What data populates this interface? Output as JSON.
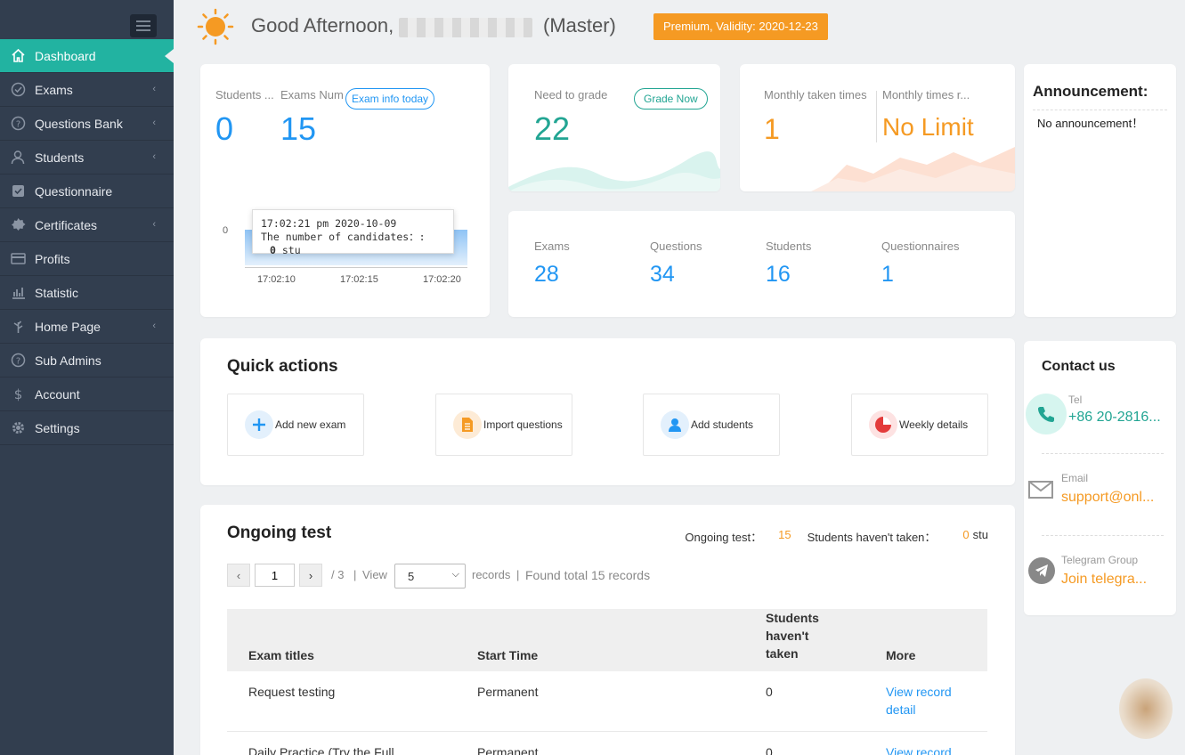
{
  "sidebar": {
    "items": [
      {
        "label": "Dashboard",
        "icon": "home-icon",
        "active": true,
        "has_chevron": false
      },
      {
        "label": "Exams",
        "icon": "check-circle-icon",
        "active": false,
        "has_chevron": true
      },
      {
        "label": "Questions Bank",
        "icon": "question-circle-icon",
        "active": false,
        "has_chevron": true
      },
      {
        "label": "Students",
        "icon": "user-icon",
        "active": false,
        "has_chevron": true
      },
      {
        "label": "Questionnaire",
        "icon": "checkbox-icon",
        "active": false,
        "has_chevron": false
      },
      {
        "label": "Certificates",
        "icon": "badge-icon",
        "active": false,
        "has_chevron": true
      },
      {
        "label": "Profits",
        "icon": "card-icon",
        "active": false,
        "has_chevron": false
      },
      {
        "label": "Statistic",
        "icon": "bar-chart-icon",
        "active": false,
        "has_chevron": false
      },
      {
        "label": "Home Page",
        "icon": "leaf-icon",
        "active": false,
        "has_chevron": true
      },
      {
        "label": "Sub Admins",
        "icon": "question-circle-icon",
        "active": false,
        "has_chevron": false
      },
      {
        "label": "Account",
        "icon": "dollar-icon",
        "active": false,
        "has_chevron": false
      },
      {
        "label": "Settings",
        "icon": "gear-icon",
        "active": false,
        "has_chevron": false
      }
    ]
  },
  "header": {
    "greeting": "Good Afternoon,",
    "role": "(Master)",
    "premium": "Premium, Validity: 2020-12-23"
  },
  "exam_today": {
    "students_label": "Students ...",
    "exams_label": "Exams Num",
    "info_button": "Exam info today",
    "students_value": "0",
    "exams_value": "15",
    "chart_y_tick": "0",
    "tooltip_time": "17:02:21 pm 2020-10-09",
    "tooltip_label": "The number of candidates：:",
    "tooltip_value": "0",
    "tooltip_unit": "stu",
    "x_ticks": [
      "17:02:10",
      "17:02:15",
      "17:02:20"
    ]
  },
  "grade": {
    "label": "Need to grade",
    "button": "Grade Now",
    "value": "22"
  },
  "monthly": {
    "taken_label": "Monthly taken times",
    "remaining_label": "Monthly times r...",
    "taken_value": "1",
    "remaining_value": "No Limit"
  },
  "totals": [
    {
      "label": "Exams",
      "value": "28"
    },
    {
      "label": "Questions",
      "value": "34"
    },
    {
      "label": "Students",
      "value": "16"
    },
    {
      "label": "Questionnaires",
      "value": "1"
    }
  ],
  "announcement": {
    "title": "Announcement:",
    "text": "No announcement！"
  },
  "quick_actions": {
    "title": "Quick actions",
    "items": [
      {
        "label": "Add new exam",
        "icon": "plus-icon",
        "color": "#2196f3"
      },
      {
        "label": "Import questions",
        "icon": "document-icon",
        "color": "#f59a23"
      },
      {
        "label": "Add students",
        "icon": "user-add-icon",
        "color": "#2196f3"
      },
      {
        "label": "Weekly details",
        "icon": "pie-chart-icon",
        "color": "#e33b3b"
      }
    ]
  },
  "contact": {
    "title": "Contact us",
    "tel_label": "Tel",
    "tel_value": "+86 20-2816...",
    "email_label": "Email",
    "email_value": "support@onl...",
    "telegram_label": "Telegram Group",
    "telegram_value": "Join telegra..."
  },
  "ongoing": {
    "title": "Ongoing test",
    "ongoing_label": "Ongoing test：",
    "ongoing_value": "15",
    "not_taken_label": "Students haven't taken：",
    "not_taken_value": "0",
    "not_taken_unit": "stu",
    "page_current": "1",
    "page_total": "/ 3",
    "view_label": "View",
    "page_size": "5",
    "records_label": "records",
    "found_label": "Found total 15 records",
    "columns": [
      "Exam titles",
      "Start Time",
      "Students haven't taken",
      "More"
    ],
    "rows": [
      {
        "title": "Request testing",
        "start": "Permanent",
        "not_taken": "0",
        "more": "View record detail"
      },
      {
        "title": "Daily Practice (Try the Full Screen)",
        "start": "Permanent",
        "not_taken": "0",
        "more": "View record detail"
      }
    ]
  },
  "colors": {
    "sidebar_bg": "#323e4f",
    "active": "#22b3a1",
    "blue": "#2196f3",
    "orange": "#f59a23",
    "teal": "#22a593"
  }
}
